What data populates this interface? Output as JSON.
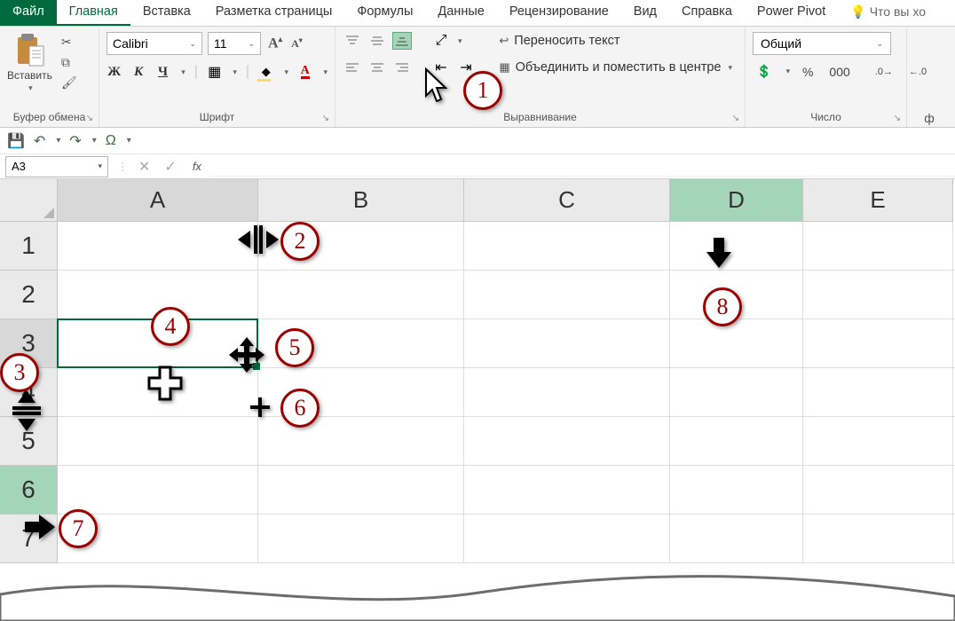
{
  "tabs": {
    "file": "Файл",
    "home": "Главная",
    "insert": "Вставка",
    "layout": "Разметка страницы",
    "formulas": "Формулы",
    "data": "Данные",
    "review": "Рецензирование",
    "view": "Вид",
    "help": "Справка",
    "powerpivot": "Power Pivot",
    "tell": "Что вы хо"
  },
  "ribbon": {
    "clipboard": {
      "paste": "Вставить",
      "title": "Буфер обмена"
    },
    "font": {
      "name": "Calibri",
      "size": "11",
      "bold": "Ж",
      "italic": "К",
      "underline": "Ч",
      "title": "Шрифт"
    },
    "align": {
      "wrap": "Переносить текст",
      "merge": "Объединить и поместить в центре",
      "title": "Выравнивание"
    },
    "number": {
      "format": "Общий",
      "pct": "%",
      "comma": "000",
      "title": "Число"
    },
    "extra": "ф"
  },
  "fbar": {
    "cell": "A3"
  },
  "grid": {
    "cols": [
      "A",
      "B",
      "C",
      "D",
      "E"
    ],
    "rows": [
      "1",
      "2",
      "3",
      "4",
      "5",
      "6",
      "7"
    ]
  },
  "annotations": [
    "1",
    "2",
    "3",
    "4",
    "5",
    "6",
    "7",
    "8"
  ]
}
